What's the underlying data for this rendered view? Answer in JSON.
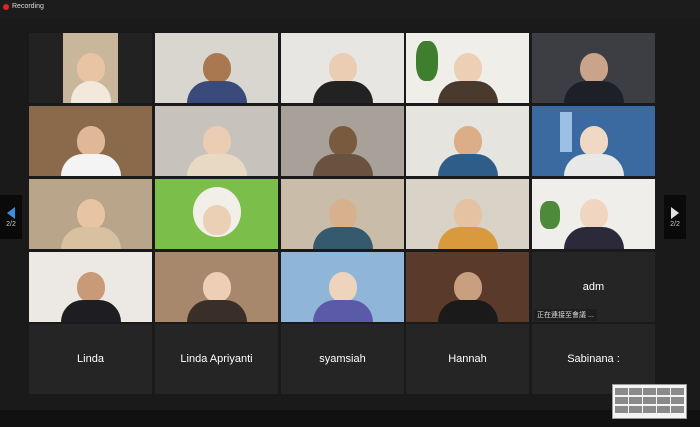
{
  "recording": {
    "label": "Recording"
  },
  "navigation": {
    "page_indicator_left": "2/2",
    "page_indicator_right": "2/2"
  },
  "participants": [
    {
      "id": "p1"
    },
    {
      "id": "p2"
    },
    {
      "id": "p3"
    },
    {
      "id": "p4"
    },
    {
      "id": "p5"
    },
    {
      "id": "p6"
    },
    {
      "id": "p7"
    },
    {
      "id": "p8"
    },
    {
      "id": "p9"
    },
    {
      "id": "p10"
    },
    {
      "id": "p11"
    },
    {
      "id": "p12"
    },
    {
      "id": "p13"
    },
    {
      "id": "p14"
    },
    {
      "id": "p15"
    },
    {
      "id": "p16"
    },
    {
      "id": "p17"
    },
    {
      "id": "p18"
    },
    {
      "id": "p19"
    },
    {
      "id": "p20",
      "name": "adm",
      "status": "正在連接至會議 ..."
    }
  ],
  "name_only_tiles": [
    "Linda",
    "Linda Apriyanti",
    "syamsiah",
    "Hannah",
    "Sabinana :"
  ],
  "colors": {
    "recording_dot": "#e02424",
    "nav_arrow": "#3b8fe0",
    "tile_bg": "#252525"
  }
}
